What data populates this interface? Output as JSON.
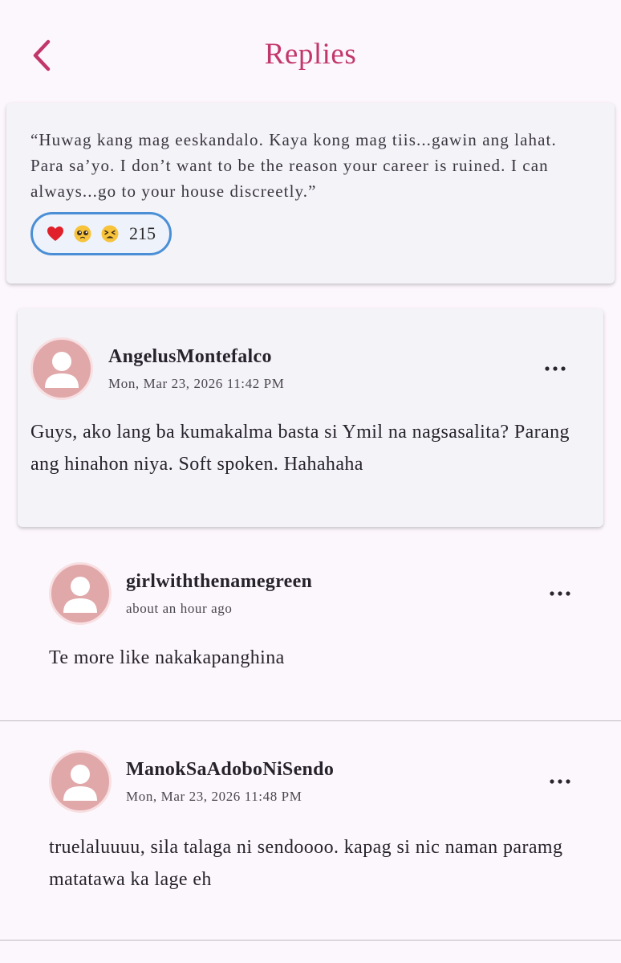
{
  "header": {
    "title": "Replies",
    "back_icon": "chevron-left-icon",
    "accent_color": "#c2376b"
  },
  "quote": {
    "text": "“Huwag kang mag eeskandalo. Kaya kong mag tiis...gawin ang lahat. Para sa’yo. I don’t want to be the reason your career is ruined. I can always...go to your house discreetly.”",
    "reactions": {
      "emojis": [
        "red-heart-emoji",
        "pleading-face-emoji",
        "tired-face-emoji"
      ],
      "count": "215",
      "border_color": "#4a8fd6"
    }
  },
  "main_comment": {
    "username": "AngelusMontefalco",
    "timestamp": "Mon, Mar 23, 2026 11:42 PM",
    "body": "Guys, ako lang ba kumakalma basta si Ymil na nagsasalita? Parang ang hinahon niya. Soft spoken. Hahahaha",
    "more_icon": "more-horizontal-icon"
  },
  "replies": [
    {
      "username": "girlwiththenamegreen",
      "timestamp": "about an hour ago",
      "body": "Te more like nakakapanghina",
      "more_icon": "more-horizontal-icon"
    },
    {
      "username": "ManokSaAdoboNiSendo",
      "timestamp": "Mon, Mar 23, 2026 11:48 PM",
      "body": "truelaluuuu, sila talaga ni sendoooo. kapag si nic naman paramg matatawa ka lage eh",
      "more_icon": "more-horizontal-icon"
    }
  ]
}
